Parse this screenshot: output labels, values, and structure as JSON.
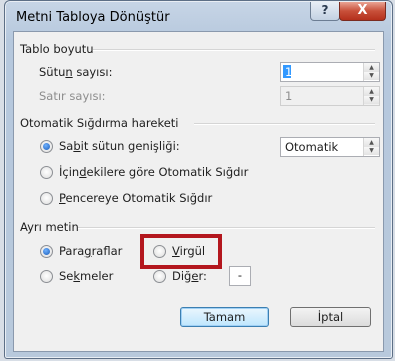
{
  "dialog": {
    "title": "Metni Tabloya Dönüştür",
    "help_glyph": "?",
    "close_glyph": "X"
  },
  "table_size": {
    "heading": "Tablo boyutu",
    "columns_label_pre": "Sütu",
    "columns_label_u": "n",
    "columns_label_post": " sayısı:",
    "columns_value": "1",
    "rows_label": "Satır sayısı:",
    "rows_value": "1"
  },
  "autofit": {
    "heading": "Otomatik Sığdırma hareketi",
    "fixed_pre": "Sa",
    "fixed_u": "b",
    "fixed_post": "it sütun genişliği:",
    "fixed_value": "Otomatik",
    "content_pre": "İçin",
    "content_u": "d",
    "content_post": "ekilere göre Otomatik Sığdır",
    "window_u": "P",
    "window_post": "encereye Otomatik Sığdır"
  },
  "separate": {
    "heading": "Ayrı metin",
    "paragraphs_pre": "Para",
    "paragraphs_u": "g",
    "paragraphs_post": "raflar",
    "comma_u": "V",
    "comma_post": "irgül",
    "tabs_pre": "Se",
    "tabs_u": "k",
    "tabs_post": "meler",
    "other_pre": "Diğ",
    "other_u": "e",
    "other_post": "r:",
    "other_value": "-"
  },
  "buttons": {
    "ok": "Tamam",
    "cancel": "İptal"
  },
  "colors": {
    "highlight_box": "#b3161d",
    "selected_radio": "#1c5db8"
  }
}
